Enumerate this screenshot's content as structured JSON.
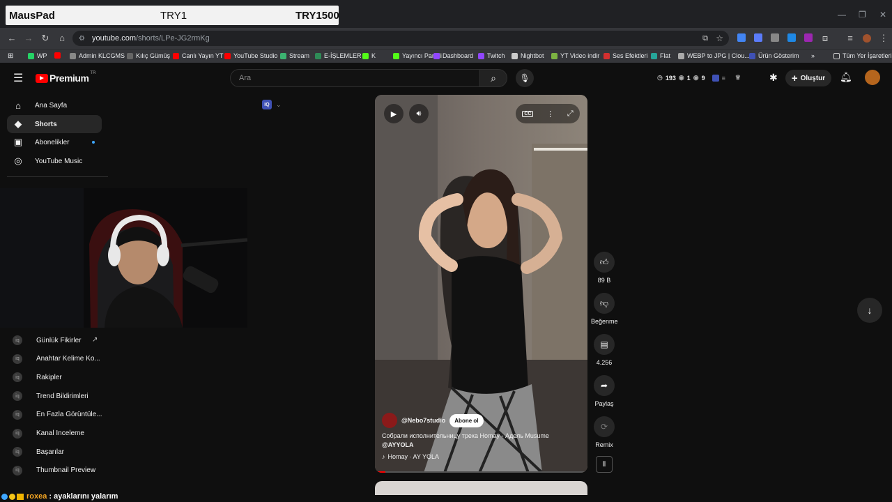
{
  "overlay": {
    "left": "MausPad",
    "mid": "TRY1",
    "right": "TRY1500"
  },
  "browser": {
    "url_host": "youtube.com",
    "url_path": "/shorts/LPe-JG2rmKg",
    "bookmarks": [
      {
        "label": "WP",
        "color": "#25d366"
      },
      {
        "label": "",
        "color": "#ff0000"
      },
      {
        "label": "Admin KLCGMS",
        "color": "#888888"
      },
      {
        "label": "Kılıç Gümüş",
        "color": "#666666"
      },
      {
        "label": "Canlı Yayın YT",
        "color": "#ff0000"
      },
      {
        "label": "YouTube Studio",
        "color": "#ff0000"
      },
      {
        "label": "Stream",
        "color": "#3cb371"
      },
      {
        "label": "E-İŞLEMLER",
        "color": "#2e8b57"
      },
      {
        "label": "K",
        "color": "#53fc18"
      },
      {
        "label": "Yayıncı Paneli",
        "color": "#53fc18"
      },
      {
        "label": "Dashboard",
        "color": "#9146ff"
      },
      {
        "label": "Twitch",
        "color": "#9146ff"
      },
      {
        "label": "Nightbot",
        "color": "#cccccc"
      },
      {
        "label": "YT Video indir",
        "color": "#7cb342"
      },
      {
        "label": "Ses Efektleri",
        "color": "#d32f2f"
      },
      {
        "label": "Flat",
        "color": "#26a69a"
      },
      {
        "label": "WEBP to JPG | Clou...",
        "color": "#aaaaaa"
      },
      {
        "label": "Ürün Gösterim",
        "color": "#3f51b5"
      }
    ],
    "bookmarks_overflow": "»",
    "all_bookmarks": "Tüm Yer İşaretleri"
  },
  "header": {
    "logo": "Premium",
    "logo_badge": "TR",
    "search_placeholder": "Ara",
    "stats": {
      "views": "193",
      "likes": "1",
      "count": "9"
    },
    "create_label": "Oluştur"
  },
  "sidebar": {
    "items": [
      {
        "label": "Ana Sayfa",
        "icon": "home-icon"
      },
      {
        "label": "Shorts",
        "icon": "shorts-icon"
      },
      {
        "label": "Abonelikler",
        "icon": "subscriptions-icon"
      },
      {
        "label": "YouTube Music",
        "icon": "music-icon"
      }
    ],
    "tools": [
      {
        "label": "Günlük Fikirler"
      },
      {
        "label": "Anahtar Kelime Ko..."
      },
      {
        "label": "Rakipler"
      },
      {
        "label": "Trend Bildirimleri"
      },
      {
        "label": "En Fazla Görüntüle..."
      },
      {
        "label": "Kanal Inceleme"
      },
      {
        "label": "Başarılar"
      },
      {
        "label": "Thumbnail Preview"
      }
    ]
  },
  "vidiq_badge": "IQ",
  "short": {
    "channel": "@Nebo7studio",
    "subscribe": "Abone ol",
    "title_line1": "Собрали исполнительницу трека Homay - Адель Musume",
    "title_line2": "@AYYOLA",
    "music": "Homay · AY YOLA"
  },
  "actions": {
    "likes": "89 B",
    "dislike": "Beğenme",
    "comments": "4.256",
    "share": "Paylaş",
    "remix": "Remix"
  },
  "chat": {
    "user": "roxea",
    "message": ": ayaklarını yalarım"
  },
  "colors": {
    "yt_red": "#ff0000",
    "accent_blue": "#3ea6ff"
  }
}
